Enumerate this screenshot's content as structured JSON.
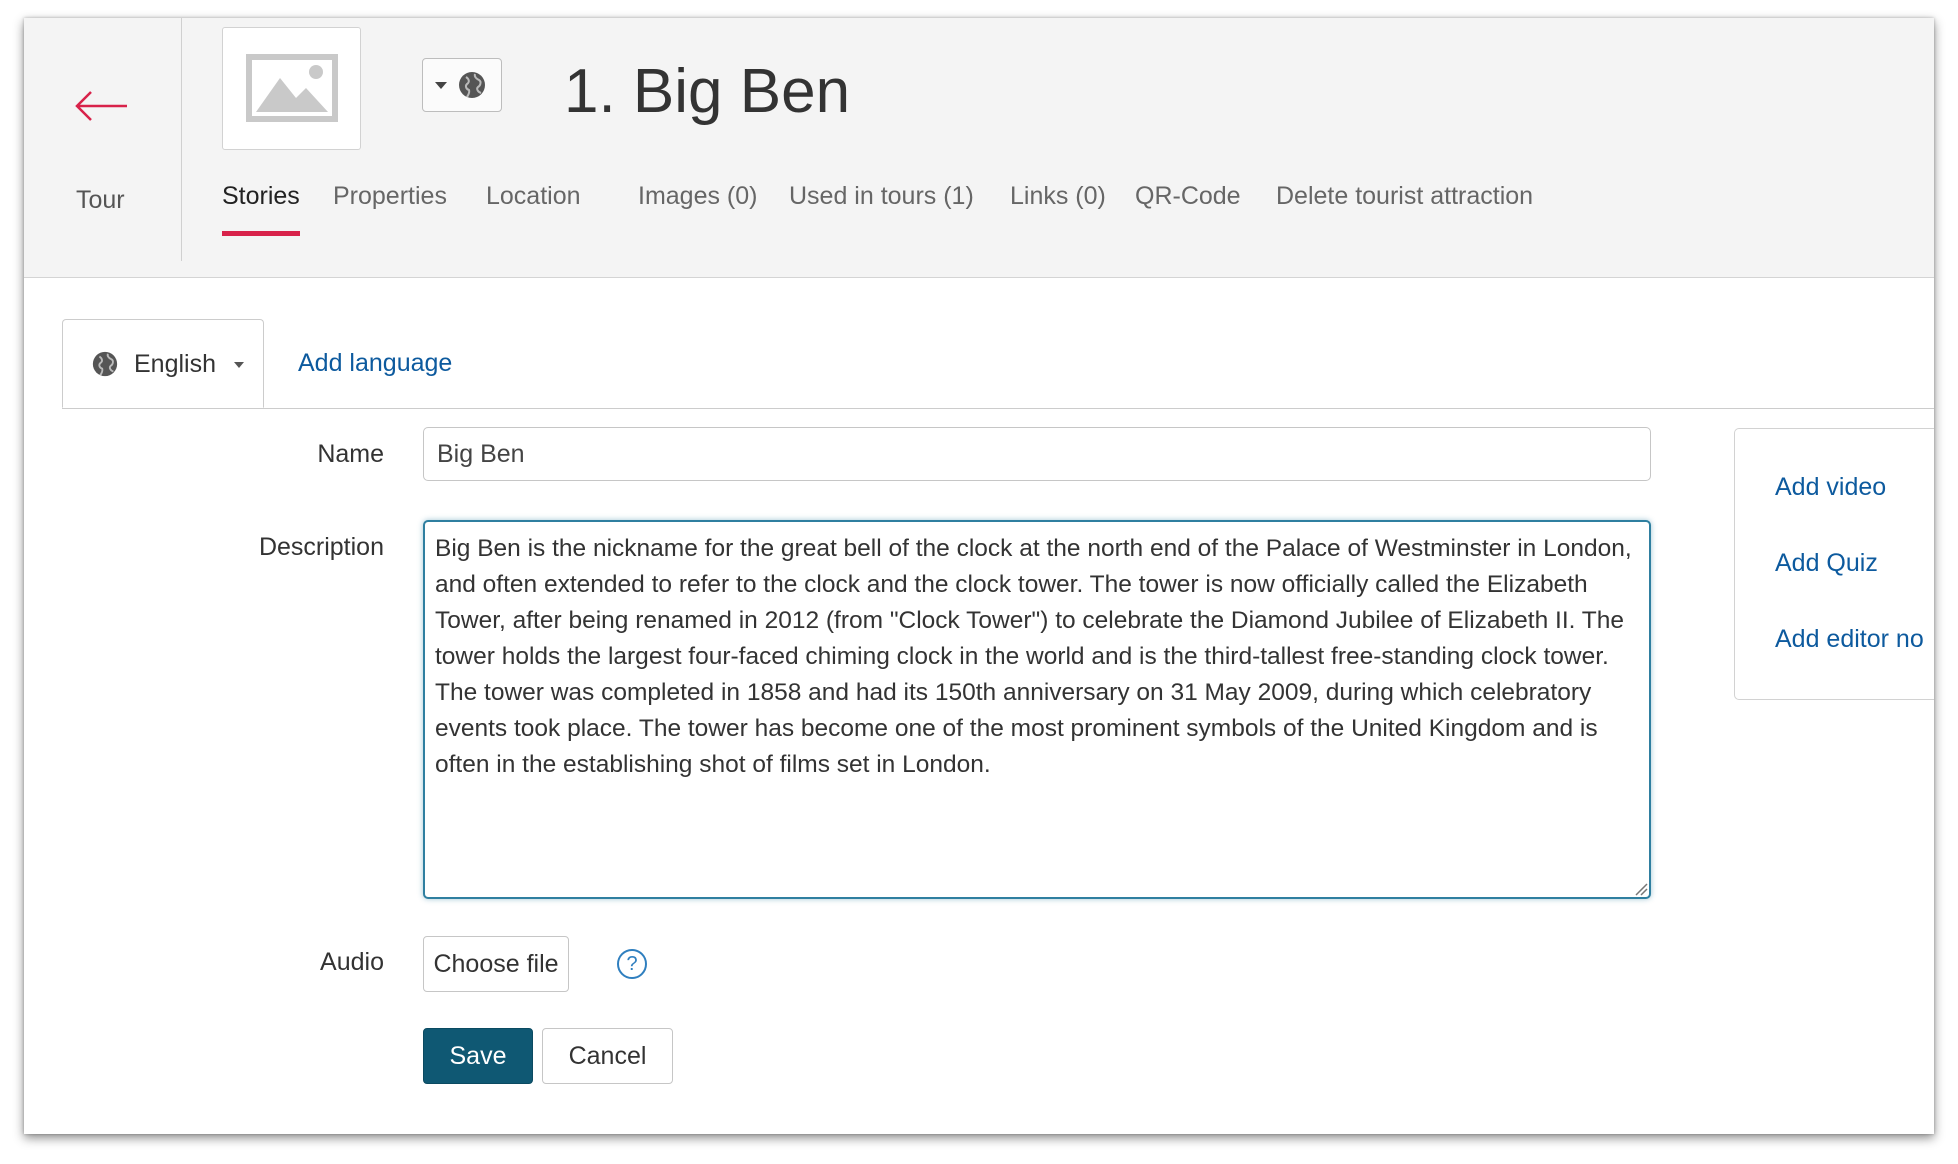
{
  "header": {
    "back_label": "Tour",
    "title": "1. Big Ben",
    "tabs": [
      {
        "label": "Stories",
        "active": true
      },
      {
        "label": "Properties"
      },
      {
        "label": "Location"
      },
      {
        "label": "Images (0)"
      },
      {
        "label": "Used in tours (1)"
      },
      {
        "label": "Links (0)"
      },
      {
        "label": "QR-Code"
      },
      {
        "label": "Delete tourist attraction"
      }
    ]
  },
  "language": {
    "selected": "English",
    "add_label": "Add language"
  },
  "form": {
    "name_label": "Name",
    "name_value": "Big Ben",
    "description_label": "Description",
    "description_value": "Big Ben is the nickname for the great bell of the clock at the north end of the Palace of Westminster in London, and often extended to refer to the clock and the clock tower. The tower is now officially called the Elizabeth Tower, after being renamed in 2012 (from \"Clock Tower\") to celebrate the Diamond Jubilee of Elizabeth II. The tower holds the largest four-faced chiming clock in the world and is the third-tallest free-standing clock tower. The tower was completed in 1858 and had its 150th anniversary on 31 May 2009, during which celebratory events took place. The tower has become one of the most prominent symbols of the United Kingdom and is often in the establishing shot of films set in London.",
    "audio_label": "Audio",
    "choose_file_label": "Choose file",
    "help_label": "?",
    "save_label": "Save",
    "cancel_label": "Cancel"
  },
  "side_panel": {
    "links": [
      "Add video",
      "Add Quiz",
      "Add editor no"
    ]
  },
  "colors": {
    "accent_red": "#d8224a",
    "link_blue": "#0d5a9e",
    "save_bg": "#0f5873",
    "focus_border": "#2f7fa0"
  }
}
